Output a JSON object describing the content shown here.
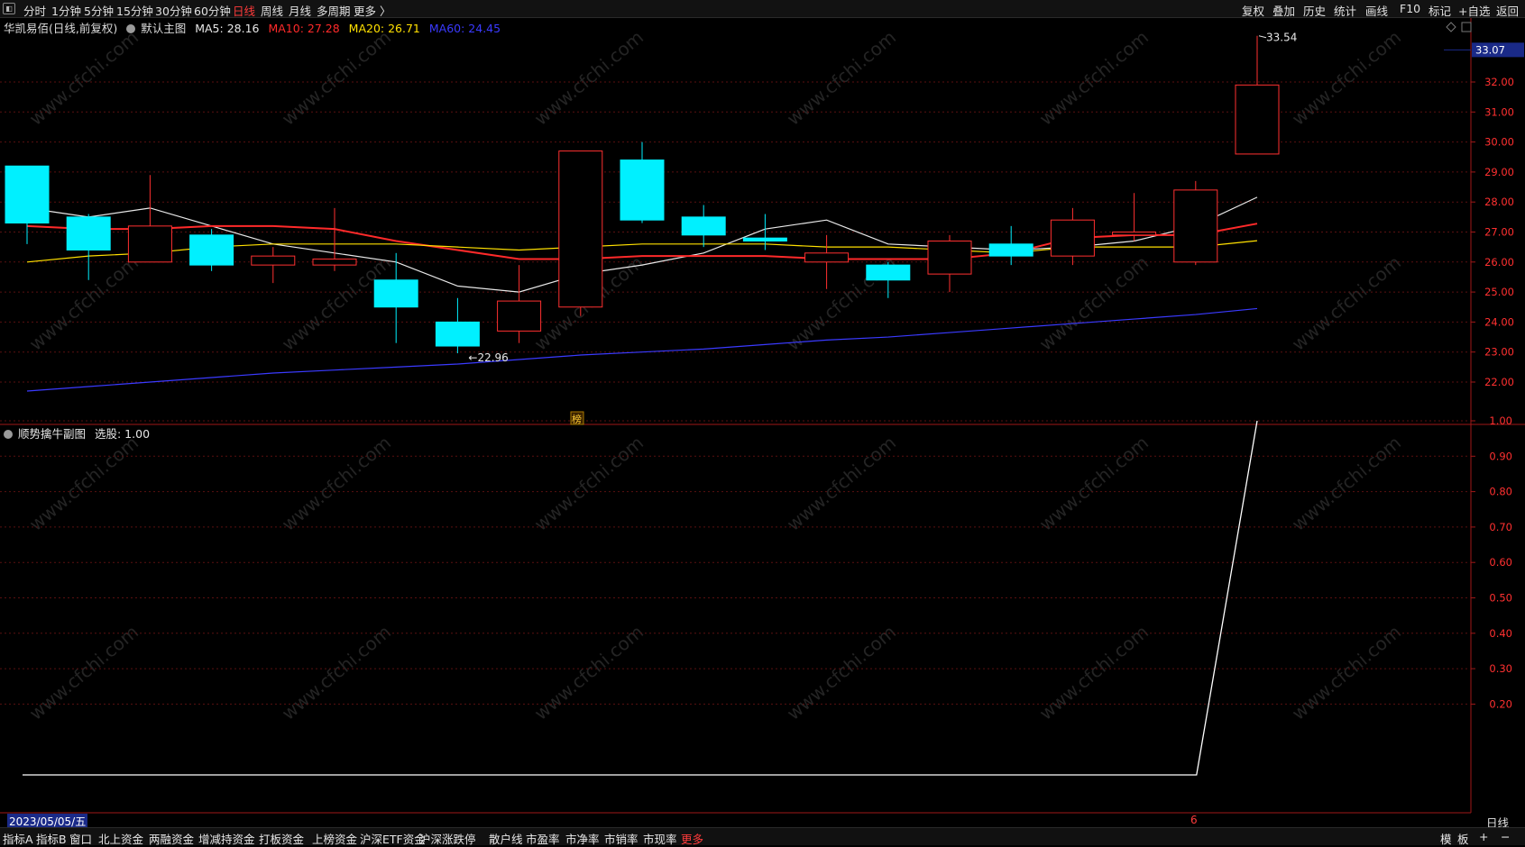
{
  "topbar": {
    "periods": [
      "分时",
      "1分钟",
      "5分钟",
      "15分钟",
      "30分钟",
      "60分钟",
      "日线",
      "周线",
      "月线",
      "多周期",
      "更多 〉"
    ],
    "active_period": "日线",
    "right_tools": [
      "复权",
      "叠加",
      "历史",
      "统计",
      "画线",
      "F10",
      "标记",
      "+自选",
      "返回"
    ]
  },
  "main_chart": {
    "stock_title": "华凯易佰(日线,前复权)",
    "indicator_name": "默认主图",
    "ma_labels": [
      {
        "text": "MA5: 28.16",
        "color": "#e8e8e8"
      },
      {
        "text": "MA10: 27.28",
        "color": "#ff2a2a"
      },
      {
        "text": "MA20: 26.71",
        "color": "#ffe000"
      },
      {
        "text": "MA60: 24.45",
        "color": "#3a3aff"
      }
    ],
    "current_price": "33.07",
    "high_label": "33.54",
    "low_label": "22.96",
    "marker_glyph": "榜",
    "y_axis_ticks": [
      "32.00",
      "31.00",
      "30.00",
      "29.00",
      "28.00",
      "27.00",
      "26.00",
      "25.00",
      "24.00",
      "23.00",
      "22.00"
    ]
  },
  "chart_data": [
    {
      "type": "candlestick",
      "title": "华凯易佰(日线,前复权)",
      "ylim": [
        21.5,
        34.2
      ],
      "candles": [
        {
          "o": 29.2,
          "c": 27.3,
          "h": 29.2,
          "l": 26.6
        },
        {
          "o": 27.5,
          "c": 26.4,
          "h": 27.6,
          "l": 25.4
        },
        {
          "o": 26.0,
          "c": 27.2,
          "h": 28.9,
          "l": 26.0
        },
        {
          "o": 26.9,
          "c": 25.9,
          "h": 27.1,
          "l": 25.7
        },
        {
          "o": 25.9,
          "c": 26.2,
          "h": 26.5,
          "l": 25.3
        },
        {
          "o": 25.9,
          "c": 26.1,
          "h": 27.8,
          "l": 25.7
        },
        {
          "o": 25.4,
          "c": 24.5,
          "h": 26.3,
          "l": 23.3
        },
        {
          "o": 24.0,
          "c": 23.2,
          "h": 24.8,
          "l": 22.96
        },
        {
          "o": 23.7,
          "c": 24.7,
          "h": 25.9,
          "l": 23.3
        },
        {
          "o": 24.5,
          "c": 29.7,
          "h": 29.7,
          "l": 24.2
        },
        {
          "o": 29.4,
          "c": 27.4,
          "h": 30.0,
          "l": 27.3
        },
        {
          "o": 27.5,
          "c": 26.9,
          "h": 27.9,
          "l": 26.5
        },
        {
          "o": 26.8,
          "c": 26.7,
          "h": 27.6,
          "l": 26.4
        },
        {
          "o": 26.0,
          "c": 26.3,
          "h": 26.9,
          "l": 25.1
        },
        {
          "o": 25.9,
          "c": 25.4,
          "h": 26.0,
          "l": 24.8
        },
        {
          "o": 25.6,
          "c": 26.7,
          "h": 26.9,
          "l": 25.0
        },
        {
          "o": 26.6,
          "c": 26.2,
          "h": 27.2,
          "l": 25.9
        },
        {
          "o": 26.2,
          "c": 27.4,
          "h": 27.8,
          "l": 25.9
        },
        {
          "o": 26.9,
          "c": 27.0,
          "h": 28.3,
          "l": 26.7
        },
        {
          "o": 26.0,
          "c": 28.4,
          "h": 28.7,
          "l": 25.9
        },
        {
          "o": 29.6,
          "c": 31.9,
          "h": 33.54,
          "l": 29.6
        }
      ],
      "series": [
        {
          "name": "MA5",
          "color": "#e8e8e8",
          "values": [
            27.8,
            27.5,
            27.8,
            27.2,
            26.6,
            26.3,
            26.0,
            25.2,
            25.0,
            25.6,
            25.9,
            26.3,
            27.1,
            27.4,
            26.6,
            26.5,
            26.4,
            26.5,
            26.7,
            27.2,
            28.16
          ]
        },
        {
          "name": "MA10",
          "color": "#ff2a2a",
          "values": [
            27.2,
            27.1,
            27.1,
            27.2,
            27.2,
            27.1,
            26.7,
            26.4,
            26.1,
            26.1,
            26.2,
            26.2,
            26.2,
            26.1,
            26.1,
            26.1,
            26.3,
            26.8,
            26.9,
            26.9,
            27.28
          ]
        },
        {
          "name": "MA20",
          "color": "#ffe000",
          "values": [
            26.0,
            26.2,
            26.3,
            26.5,
            26.6,
            26.6,
            26.6,
            26.5,
            26.4,
            26.5,
            26.6,
            26.6,
            26.6,
            26.5,
            26.5,
            26.4,
            26.3,
            26.5,
            26.5,
            26.5,
            26.71
          ]
        },
        {
          "name": "MA60",
          "color": "#3a3aff",
          "values": [
            21.7,
            21.85,
            22.0,
            22.15,
            22.3,
            22.4,
            22.5,
            22.6,
            22.75,
            22.9,
            23.0,
            23.1,
            23.25,
            23.4,
            23.5,
            23.65,
            23.8,
            23.95,
            24.1,
            24.25,
            24.45
          ]
        }
      ]
    },
    {
      "type": "line",
      "title": "顺势擒牛副图",
      "ylim": [
        0,
        1.05
      ],
      "series": [
        {
          "name": "选股",
          "color": "#ffffff",
          "values": [
            0,
            0,
            0,
            0,
            0,
            0,
            0,
            0,
            0,
            0,
            0,
            0,
            0,
            0,
            0,
            0,
            0,
            0,
            0,
            0,
            1.0
          ]
        }
      ]
    }
  ],
  "sub_chart": {
    "indicator_name": "顺势擒牛副图",
    "value_label": "选股: 1.00",
    "y_axis_ticks": [
      "1.00",
      "0.90",
      "0.80",
      "0.70",
      "0.60",
      "0.50",
      "0.40",
      "0.30",
      "0.20"
    ]
  },
  "datebar": {
    "cursor_date": "2023/05/05/五",
    "month_marker": "6",
    "period_label": "日线"
  },
  "bottombar": {
    "tabs": [
      "指标A",
      "指标B",
      "窗口",
      "北上资金",
      "两融资金",
      "增减持资金",
      "打板资金",
      "上榜资金",
      "沪深ETF资金",
      "沪深涨跌停",
      "散户线",
      "市盈率",
      "市净率",
      "市销率",
      "市现率",
      "更多"
    ],
    "right_items": [
      "模",
      "板",
      "+",
      "−"
    ]
  },
  "watermark": "www.cfchi.com"
}
